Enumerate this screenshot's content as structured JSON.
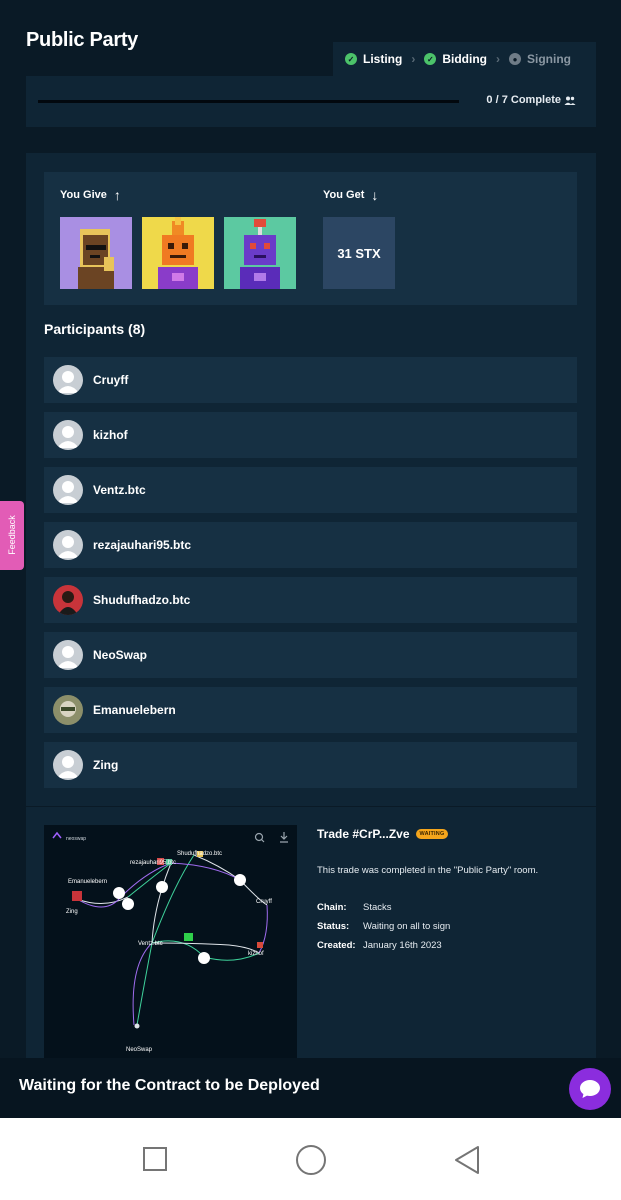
{
  "page": {
    "title": "Public Party"
  },
  "steps": [
    {
      "label": "Listing",
      "state": "done"
    },
    {
      "label": "Bidding",
      "state": "done"
    },
    {
      "label": "Signing",
      "state": "pending"
    }
  ],
  "progress": {
    "text": "0 / 7 Complete",
    "fraction": 0
  },
  "trade_assets": {
    "give_label": "You Give",
    "get_label": "You Get",
    "give_items": [
      "nft-1",
      "nft-2",
      "nft-3"
    ],
    "get_value": "31 STX"
  },
  "participants": {
    "title": "Participants (8)",
    "list": [
      {
        "name": "Cruyff"
      },
      {
        "name": "kizhof"
      },
      {
        "name": "Ventz.btc"
      },
      {
        "name": "rezajauhari95.btc"
      },
      {
        "name": "Shudufhadzo.btc"
      },
      {
        "name": "NeoSwap"
      },
      {
        "name": "Emanuelebern"
      },
      {
        "name": "Zing"
      }
    ]
  },
  "trade": {
    "title": "Trade #CrP...Zve",
    "badge": "WAITING",
    "description": "This trade was completed in the \"Public Party\" room.",
    "chain_label": "Chain:",
    "chain_value": "Stacks",
    "status_label": "Status:",
    "status_value": "Waiting on all to sign",
    "created_label": "Created:",
    "created_value": "January 16th 2023"
  },
  "graph": {
    "logo_text": "neoswap",
    "nodes": [
      "Shudufhadzo.btc",
      "rezajauhari95.btc",
      "Emanuelebern",
      "Zing",
      "Cruyff",
      "Ventz.btc",
      "kizhof",
      "NeoSwap"
    ]
  },
  "feedback": {
    "label": "Feedback"
  },
  "banner": {
    "text": "Waiting for the Contract to be Deployed"
  },
  "colors": {
    "accent": "#8b2dde",
    "success": "#4cc36a",
    "badge": "#f4a51c",
    "feedback": "#e25cb6"
  }
}
